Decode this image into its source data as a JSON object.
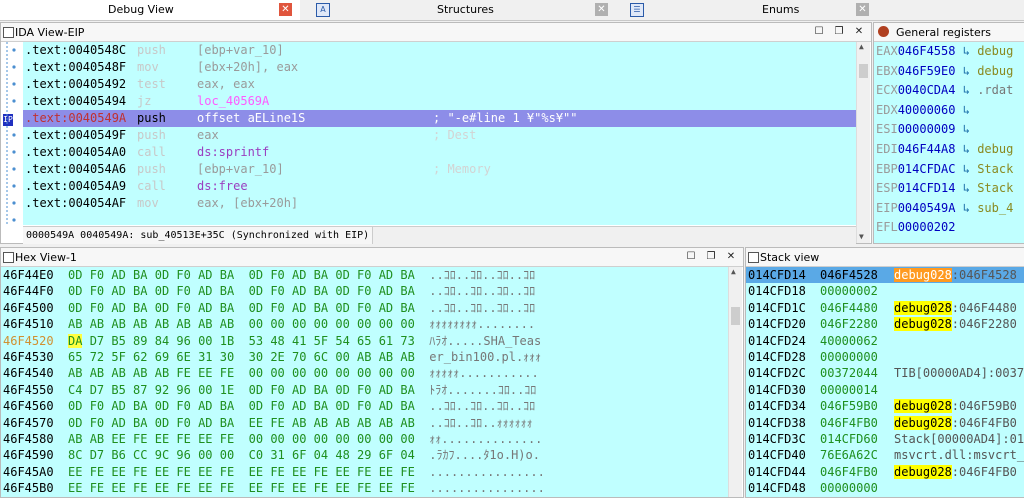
{
  "tabs": [
    {
      "label": "Debug View"
    },
    {
      "label": "Structures",
      "icon": "A"
    },
    {
      "label": "Enums"
    }
  ],
  "disasm": {
    "title": "IDA View-EIP",
    "eip_marker": "IP",
    "lines": [
      {
        "addr": ".text:0040548C",
        "mn": "push",
        "op": "[ebp+var_10]",
        "comment": ""
      },
      {
        "addr": ".text:0040548F",
        "mn": "mov",
        "op": "[ebx+20h], eax",
        "comment": ""
      },
      {
        "addr": ".text:00405492",
        "mn": "test",
        "op": "eax, eax",
        "comment": ""
      },
      {
        "addr": ".text:00405494",
        "mn": "jz",
        "op": "loc_40569A",
        "comment": ""
      },
      {
        "addr": ".text:0040549A",
        "mn": "push",
        "op": "offset aELine1S",
        "comment": "; \"-e#line 1 ¥\"%s¥\"\""
      },
      {
        "addr": ".text:0040549F",
        "mn": "push",
        "op": "eax",
        "comment": "; Dest"
      },
      {
        "addr": ".text:004054A0",
        "mn": "call",
        "op": "ds:sprintf",
        "comment": ""
      },
      {
        "addr": ".text:004054A6",
        "mn": "push",
        "op": "[ebp+var_10]",
        "comment": "; Memory"
      },
      {
        "addr": ".text:004054A9",
        "mn": "call",
        "op": "ds:free",
        "comment": ""
      },
      {
        "addr": ".text:004054AF",
        "mn": "mov",
        "op": "eax, [ebx+20h]",
        "comment": ""
      }
    ],
    "status": "0000549A 0040549A: sub_40513E+35C (Synchronized with EIP)"
  },
  "registers": {
    "title": "General registers",
    "items": [
      {
        "name": "EAX",
        "value": "046F4558",
        "desc": "debug"
      },
      {
        "name": "EBX",
        "value": "046F59E0",
        "desc": "debug"
      },
      {
        "name": "ECX",
        "value": "0040CDA4",
        "desc": ".rdat"
      },
      {
        "name": "EDX",
        "value": "40000060",
        "desc": ""
      },
      {
        "name": "ESI",
        "value": "00000009",
        "desc": ""
      },
      {
        "name": "EDI",
        "value": "046F44A8",
        "desc": "debug"
      },
      {
        "name": "EBP",
        "value": "014CFDAC",
        "desc": "Stack"
      },
      {
        "name": "ESP",
        "value": "014CFD14",
        "desc": "Stack"
      },
      {
        "name": "EIP",
        "value": "0040549A",
        "desc": "sub_4"
      },
      {
        "name": "EFL",
        "value": "00000202",
        "desc": ""
      }
    ]
  },
  "hex": {
    "title": "Hex View-1",
    "rows": [
      {
        "addr": "46F44E0",
        "bytes": "0D F0 AD BA 0D F0 AD BA  0D F0 AD BA 0D F0 AD BA",
        "ascii": "..ｺﾛ..ｺﾛ..ｺﾛ..ｺﾛ"
      },
      {
        "addr": "46F44F0",
        "bytes": "0D F0 AD BA 0D F0 AD BA  0D F0 AD BA 0D F0 AD BA",
        "ascii": "..ｺﾛ..ｺﾛ..ｺﾛ..ｺﾛ"
      },
      {
        "addr": "46F4500",
        "bytes": "0D F0 AD BA 0D F0 AD BA  0D F0 AD BA 0D F0 AD BA",
        "ascii": "..ｺﾛ..ｺﾛ..ｺﾛ..ｺﾛ"
      },
      {
        "addr": "46F4510",
        "bytes": "AB AB AB AB AB AB AB AB  00 00 00 00 00 00 00 00",
        "ascii": "ｫｫｫｫｫｫｫｫ........"
      },
      {
        "addr": "46F4520",
        "sel": "DA",
        "bytes": " D7 B5 89 84 96 00 1B  53 48 41 5F 54 65 61 73",
        "ascii": "ﾊﾗｵ.....SHA_Teas"
      },
      {
        "addr": "46F4530",
        "bytes": "65 72 5F 62 69 6E 31 30  30 2E 70 6C 00 AB AB AB",
        "ascii": "er_bin100.pl.ｫｫｫ"
      },
      {
        "addr": "46F4540",
        "bytes": "AB AB AB AB AB FE EE FE  00 00 00 00 00 00 00 00",
        "ascii": "ｫｫｫｫｫ..........."
      },
      {
        "addr": "46F4550",
        "bytes": "C4 D7 B5 87 92 96 00 1E  0D F0 AD BA 0D F0 AD BA",
        "ascii": "ﾄﾗｵ.......ｺﾛ..ｺﾛ"
      },
      {
        "addr": "46F4560",
        "bytes": "0D F0 AD BA 0D F0 AD BA  0D F0 AD BA 0D F0 AD BA",
        "ascii": "..ｺﾛ..ｺﾛ..ｺﾛ..ｺﾛ"
      },
      {
        "addr": "46F4570",
        "bytes": "0D F0 AD BA 0D F0 AD BA  EE FE AB AB AB AB AB AB",
        "ascii": "..ｺﾛ..ｺﾛ..ｫｫｫｫｫｫ"
      },
      {
        "addr": "46F4580",
        "bytes": "AB AB EE FE EE FE EE FE  00 00 00 00 00 00 00 00",
        "ascii": "ｫｫ.............."
      },
      {
        "addr": "46F4590",
        "bytes": "8C D7 B6 CC 9C 96 00 00  C0 31 6F 04 48 29 6F 04",
        "ascii": ".ﾗｶﾌ....ﾀ1o.H)o."
      },
      {
        "addr": "46F45A0",
        "bytes": "EE FE EE FE EE FE EE FE  EE FE EE FE EE FE EE FE",
        "ascii": "................"
      },
      {
        "addr": "46F45B0",
        "bytes": "EE FE EE FE EE FE EE FE  EE FE EE FE EE FE EE FE",
        "ascii": "................"
      }
    ]
  },
  "stack": {
    "title": "Stack view",
    "rows": [
      {
        "addr": "014CFD14",
        "value": "046F4528",
        "dbg": "debug028",
        "rest": ":046F4528"
      },
      {
        "addr": "014CFD18",
        "value": "00000002",
        "dbg": "",
        "rest": ""
      },
      {
        "addr": "014CFD1C",
        "value": "046F4480",
        "dbg": "debug028",
        "rest": ":046F4480"
      },
      {
        "addr": "014CFD20",
        "value": "046F2280",
        "dbg": "debug028",
        "rest": ":046F2280"
      },
      {
        "addr": "014CFD24",
        "value": "40000062",
        "dbg": "",
        "rest": ""
      },
      {
        "addr": "014CFD28",
        "value": "00000000",
        "dbg": "",
        "rest": ""
      },
      {
        "addr": "014CFD2C",
        "value": "00372044",
        "dbg": "",
        "rest": "TIB[00000AD4]:0037"
      },
      {
        "addr": "014CFD30",
        "value": "00000014",
        "dbg": "",
        "rest": ""
      },
      {
        "addr": "014CFD34",
        "value": "046F59B0",
        "dbg": "debug028",
        "rest": ":046F59B0"
      },
      {
        "addr": "014CFD38",
        "value": "046F4FB0",
        "dbg": "debug028",
        "rest": ":046F4FB0"
      },
      {
        "addr": "014CFD3C",
        "value": "014CFD60",
        "dbg": "",
        "rest": "Stack[00000AD4]:01"
      },
      {
        "addr": "014CFD40",
        "value": "76E6A62C",
        "dbg": "",
        "rest": "msvcrt.dll:msvcrt_"
      },
      {
        "addr": "014CFD44",
        "value": "046F4FB0",
        "dbg": "debug028",
        "rest": ":046F4FB0"
      },
      {
        "addr": "014CFD48",
        "value": "00000000",
        "dbg": "",
        "rest": ""
      }
    ]
  },
  "colors": {
    "view_bg": "#c0ffff",
    "current_line": "#8d8de8",
    "stack_current": "#5aa9e6",
    "debug_highlight": "#ffff00"
  }
}
